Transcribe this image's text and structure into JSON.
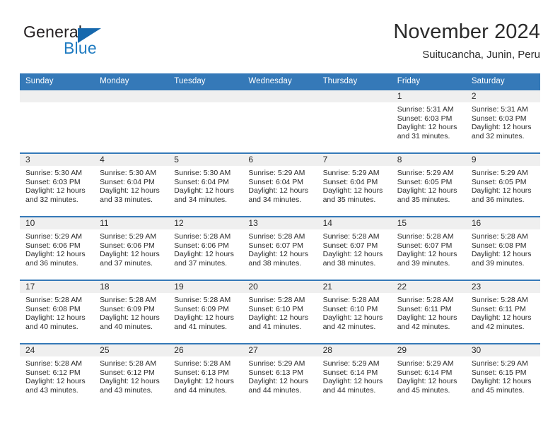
{
  "brand": {
    "name_part1": "General",
    "name_part2": "Blue",
    "triangle_color": "#1668ad",
    "blue_color": "#1f7bc1"
  },
  "header": {
    "title": "November 2024",
    "subtitle": "Suitucancha, Junin, Peru"
  },
  "theme": {
    "header_blue": "#3579b8",
    "daynum_band": "#efefef",
    "text": "#2b2b2b"
  },
  "calendar": {
    "weekday_headers": [
      "Sunday",
      "Monday",
      "Tuesday",
      "Wednesday",
      "Thursday",
      "Friday",
      "Saturday"
    ],
    "weeks": [
      [
        {
          "day": "",
          "empty": true
        },
        {
          "day": "",
          "empty": true
        },
        {
          "day": "",
          "empty": true
        },
        {
          "day": "",
          "empty": true
        },
        {
          "day": "",
          "empty": true
        },
        {
          "day": "1",
          "sunrise": "Sunrise: 5:31 AM",
          "sunset": "Sunset: 6:03 PM",
          "daylight_l1": "Daylight: 12 hours",
          "daylight_l2": "and 31 minutes."
        },
        {
          "day": "2",
          "sunrise": "Sunrise: 5:31 AM",
          "sunset": "Sunset: 6:03 PM",
          "daylight_l1": "Daylight: 12 hours",
          "daylight_l2": "and 32 minutes."
        }
      ],
      [
        {
          "day": "3",
          "sunrise": "Sunrise: 5:30 AM",
          "sunset": "Sunset: 6:03 PM",
          "daylight_l1": "Daylight: 12 hours",
          "daylight_l2": "and 32 minutes."
        },
        {
          "day": "4",
          "sunrise": "Sunrise: 5:30 AM",
          "sunset": "Sunset: 6:04 PM",
          "daylight_l1": "Daylight: 12 hours",
          "daylight_l2": "and 33 minutes."
        },
        {
          "day": "5",
          "sunrise": "Sunrise: 5:30 AM",
          "sunset": "Sunset: 6:04 PM",
          "daylight_l1": "Daylight: 12 hours",
          "daylight_l2": "and 34 minutes."
        },
        {
          "day": "6",
          "sunrise": "Sunrise: 5:29 AM",
          "sunset": "Sunset: 6:04 PM",
          "daylight_l1": "Daylight: 12 hours",
          "daylight_l2": "and 34 minutes."
        },
        {
          "day": "7",
          "sunrise": "Sunrise: 5:29 AM",
          "sunset": "Sunset: 6:04 PM",
          "daylight_l1": "Daylight: 12 hours",
          "daylight_l2": "and 35 minutes."
        },
        {
          "day": "8",
          "sunrise": "Sunrise: 5:29 AM",
          "sunset": "Sunset: 6:05 PM",
          "daylight_l1": "Daylight: 12 hours",
          "daylight_l2": "and 35 minutes."
        },
        {
          "day": "9",
          "sunrise": "Sunrise: 5:29 AM",
          "sunset": "Sunset: 6:05 PM",
          "daylight_l1": "Daylight: 12 hours",
          "daylight_l2": "and 36 minutes."
        }
      ],
      [
        {
          "day": "10",
          "sunrise": "Sunrise: 5:29 AM",
          "sunset": "Sunset: 6:06 PM",
          "daylight_l1": "Daylight: 12 hours",
          "daylight_l2": "and 36 minutes."
        },
        {
          "day": "11",
          "sunrise": "Sunrise: 5:29 AM",
          "sunset": "Sunset: 6:06 PM",
          "daylight_l1": "Daylight: 12 hours",
          "daylight_l2": "and 37 minutes."
        },
        {
          "day": "12",
          "sunrise": "Sunrise: 5:28 AM",
          "sunset": "Sunset: 6:06 PM",
          "daylight_l1": "Daylight: 12 hours",
          "daylight_l2": "and 37 minutes."
        },
        {
          "day": "13",
          "sunrise": "Sunrise: 5:28 AM",
          "sunset": "Sunset: 6:07 PM",
          "daylight_l1": "Daylight: 12 hours",
          "daylight_l2": "and 38 minutes."
        },
        {
          "day": "14",
          "sunrise": "Sunrise: 5:28 AM",
          "sunset": "Sunset: 6:07 PM",
          "daylight_l1": "Daylight: 12 hours",
          "daylight_l2": "and 38 minutes."
        },
        {
          "day": "15",
          "sunrise": "Sunrise: 5:28 AM",
          "sunset": "Sunset: 6:07 PM",
          "daylight_l1": "Daylight: 12 hours",
          "daylight_l2": "and 39 minutes."
        },
        {
          "day": "16",
          "sunrise": "Sunrise: 5:28 AM",
          "sunset": "Sunset: 6:08 PM",
          "daylight_l1": "Daylight: 12 hours",
          "daylight_l2": "and 39 minutes."
        }
      ],
      [
        {
          "day": "17",
          "sunrise": "Sunrise: 5:28 AM",
          "sunset": "Sunset: 6:08 PM",
          "daylight_l1": "Daylight: 12 hours",
          "daylight_l2": "and 40 minutes."
        },
        {
          "day": "18",
          "sunrise": "Sunrise: 5:28 AM",
          "sunset": "Sunset: 6:09 PM",
          "daylight_l1": "Daylight: 12 hours",
          "daylight_l2": "and 40 minutes."
        },
        {
          "day": "19",
          "sunrise": "Sunrise: 5:28 AM",
          "sunset": "Sunset: 6:09 PM",
          "daylight_l1": "Daylight: 12 hours",
          "daylight_l2": "and 41 minutes."
        },
        {
          "day": "20",
          "sunrise": "Sunrise: 5:28 AM",
          "sunset": "Sunset: 6:10 PM",
          "daylight_l1": "Daylight: 12 hours",
          "daylight_l2": "and 41 minutes."
        },
        {
          "day": "21",
          "sunrise": "Sunrise: 5:28 AM",
          "sunset": "Sunset: 6:10 PM",
          "daylight_l1": "Daylight: 12 hours",
          "daylight_l2": "and 42 minutes."
        },
        {
          "day": "22",
          "sunrise": "Sunrise: 5:28 AM",
          "sunset": "Sunset: 6:11 PM",
          "daylight_l1": "Daylight: 12 hours",
          "daylight_l2": "and 42 minutes."
        },
        {
          "day": "23",
          "sunrise": "Sunrise: 5:28 AM",
          "sunset": "Sunset: 6:11 PM",
          "daylight_l1": "Daylight: 12 hours",
          "daylight_l2": "and 42 minutes."
        }
      ],
      [
        {
          "day": "24",
          "sunrise": "Sunrise: 5:28 AM",
          "sunset": "Sunset: 6:12 PM",
          "daylight_l1": "Daylight: 12 hours",
          "daylight_l2": "and 43 minutes."
        },
        {
          "day": "25",
          "sunrise": "Sunrise: 5:28 AM",
          "sunset": "Sunset: 6:12 PM",
          "daylight_l1": "Daylight: 12 hours",
          "daylight_l2": "and 43 minutes."
        },
        {
          "day": "26",
          "sunrise": "Sunrise: 5:28 AM",
          "sunset": "Sunset: 6:13 PM",
          "daylight_l1": "Daylight: 12 hours",
          "daylight_l2": "and 44 minutes."
        },
        {
          "day": "27",
          "sunrise": "Sunrise: 5:29 AM",
          "sunset": "Sunset: 6:13 PM",
          "daylight_l1": "Daylight: 12 hours",
          "daylight_l2": "and 44 minutes."
        },
        {
          "day": "28",
          "sunrise": "Sunrise: 5:29 AM",
          "sunset": "Sunset: 6:14 PM",
          "daylight_l1": "Daylight: 12 hours",
          "daylight_l2": "and 44 minutes."
        },
        {
          "day": "29",
          "sunrise": "Sunrise: 5:29 AM",
          "sunset": "Sunset: 6:14 PM",
          "daylight_l1": "Daylight: 12 hours",
          "daylight_l2": "and 45 minutes."
        },
        {
          "day": "30",
          "sunrise": "Sunrise: 5:29 AM",
          "sunset": "Sunset: 6:15 PM",
          "daylight_l1": "Daylight: 12 hours",
          "daylight_l2": "and 45 minutes."
        }
      ]
    ]
  }
}
